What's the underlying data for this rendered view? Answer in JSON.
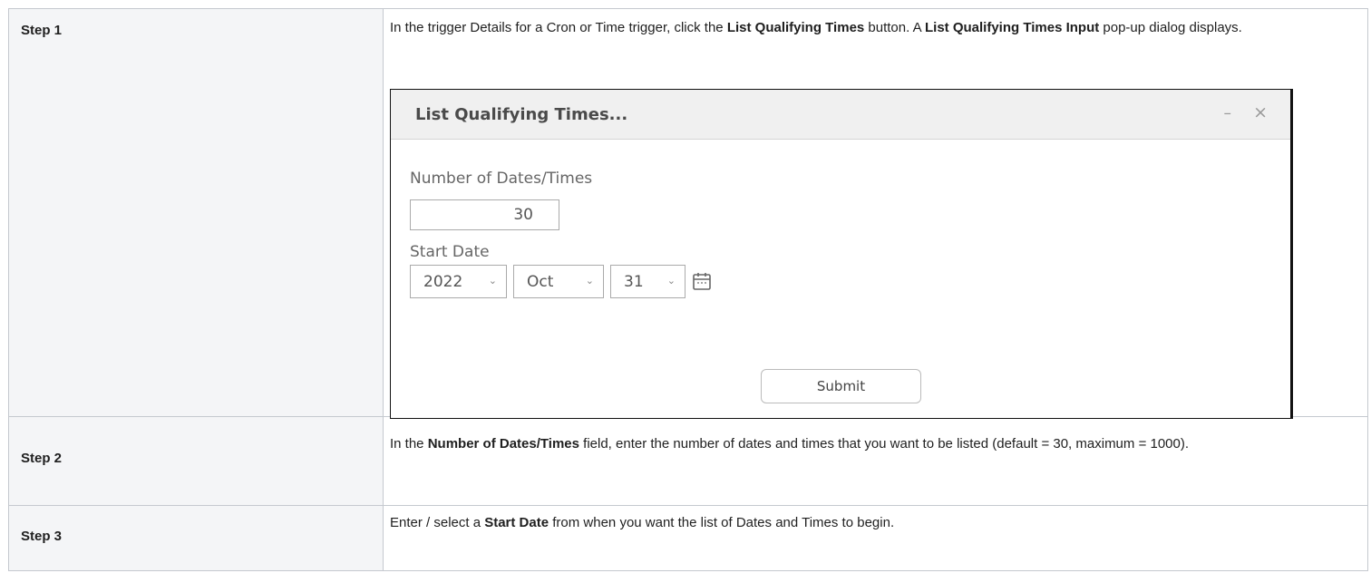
{
  "steps": [
    {
      "label": "Step 1",
      "parts": [
        {
          "text": "In the trigger Details for a Cron or Time trigger, click the ",
          "bold": false
        },
        {
          "text": "List Qualifying Times",
          "bold": true
        },
        {
          "text": " button. A ",
          "bold": false
        },
        {
          "text": "List Qualifying Times Input",
          "bold": true
        },
        {
          "text": " pop-up dialog displays.",
          "bold": false
        }
      ]
    },
    {
      "label": "Step 2",
      "parts": [
        {
          "text": "In the ",
          "bold": false
        },
        {
          "text": "Number of Dates/Times",
          "bold": true
        },
        {
          "text": " field, enter the number of dates and times that you want to be listed (default = 30, maximum = 1000).",
          "bold": false
        }
      ]
    },
    {
      "label": "Step 3",
      "parts": [
        {
          "text": "Enter / select a ",
          "bold": false
        },
        {
          "text": "Start Date",
          "bold": true
        },
        {
          "text": " from when you want the list of Dates and Times to begin.",
          "bold": false
        }
      ]
    }
  ],
  "dialog": {
    "title": "List Qualifying Times...",
    "minimize_glyph": "–",
    "close_glyph": "×",
    "number_label": "Number of Dates/Times",
    "number_value": "30",
    "start_date_label": "Start Date",
    "year": "2022",
    "month": "Oct",
    "day": "31",
    "chevron_glyph": "⌄",
    "calendar_icon": "calendar-icon",
    "submit_label": "Submit"
  }
}
